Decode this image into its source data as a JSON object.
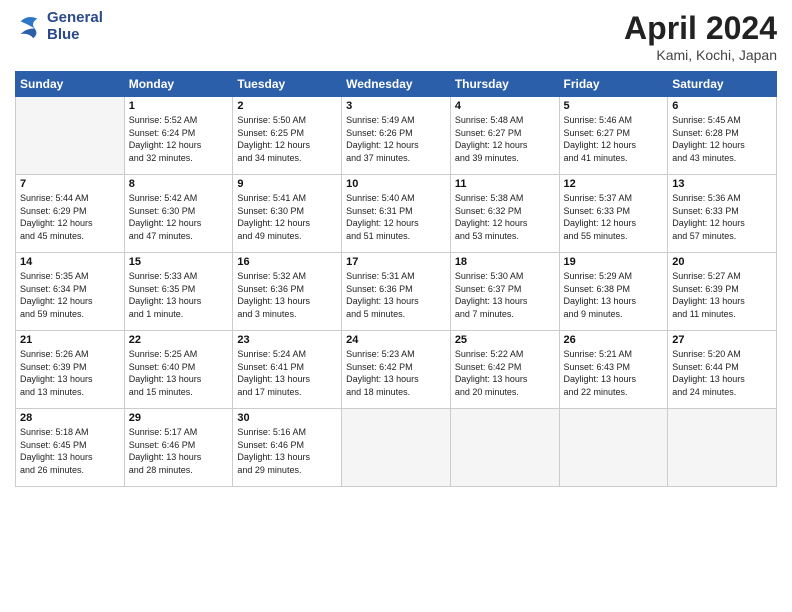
{
  "header": {
    "month_title": "April 2024",
    "location": "Kami, Kochi, Japan",
    "logo_line1": "General",
    "logo_line2": "Blue"
  },
  "weekdays": [
    "Sunday",
    "Monday",
    "Tuesday",
    "Wednesday",
    "Thursday",
    "Friday",
    "Saturday"
  ],
  "weeks": [
    [
      {
        "day": "",
        "info": ""
      },
      {
        "day": "1",
        "info": "Sunrise: 5:52 AM\nSunset: 6:24 PM\nDaylight: 12 hours\nand 32 minutes."
      },
      {
        "day": "2",
        "info": "Sunrise: 5:50 AM\nSunset: 6:25 PM\nDaylight: 12 hours\nand 34 minutes."
      },
      {
        "day": "3",
        "info": "Sunrise: 5:49 AM\nSunset: 6:26 PM\nDaylight: 12 hours\nand 37 minutes."
      },
      {
        "day": "4",
        "info": "Sunrise: 5:48 AM\nSunset: 6:27 PM\nDaylight: 12 hours\nand 39 minutes."
      },
      {
        "day": "5",
        "info": "Sunrise: 5:46 AM\nSunset: 6:27 PM\nDaylight: 12 hours\nand 41 minutes."
      },
      {
        "day": "6",
        "info": "Sunrise: 5:45 AM\nSunset: 6:28 PM\nDaylight: 12 hours\nand 43 minutes."
      }
    ],
    [
      {
        "day": "7",
        "info": "Sunrise: 5:44 AM\nSunset: 6:29 PM\nDaylight: 12 hours\nand 45 minutes."
      },
      {
        "day": "8",
        "info": "Sunrise: 5:42 AM\nSunset: 6:30 PM\nDaylight: 12 hours\nand 47 minutes."
      },
      {
        "day": "9",
        "info": "Sunrise: 5:41 AM\nSunset: 6:30 PM\nDaylight: 12 hours\nand 49 minutes."
      },
      {
        "day": "10",
        "info": "Sunrise: 5:40 AM\nSunset: 6:31 PM\nDaylight: 12 hours\nand 51 minutes."
      },
      {
        "day": "11",
        "info": "Sunrise: 5:38 AM\nSunset: 6:32 PM\nDaylight: 12 hours\nand 53 minutes."
      },
      {
        "day": "12",
        "info": "Sunrise: 5:37 AM\nSunset: 6:33 PM\nDaylight: 12 hours\nand 55 minutes."
      },
      {
        "day": "13",
        "info": "Sunrise: 5:36 AM\nSunset: 6:33 PM\nDaylight: 12 hours\nand 57 minutes."
      }
    ],
    [
      {
        "day": "14",
        "info": "Sunrise: 5:35 AM\nSunset: 6:34 PM\nDaylight: 12 hours\nand 59 minutes."
      },
      {
        "day": "15",
        "info": "Sunrise: 5:33 AM\nSunset: 6:35 PM\nDaylight: 13 hours\nand 1 minute."
      },
      {
        "day": "16",
        "info": "Sunrise: 5:32 AM\nSunset: 6:36 PM\nDaylight: 13 hours\nand 3 minutes."
      },
      {
        "day": "17",
        "info": "Sunrise: 5:31 AM\nSunset: 6:36 PM\nDaylight: 13 hours\nand 5 minutes."
      },
      {
        "day": "18",
        "info": "Sunrise: 5:30 AM\nSunset: 6:37 PM\nDaylight: 13 hours\nand 7 minutes."
      },
      {
        "day": "19",
        "info": "Sunrise: 5:29 AM\nSunset: 6:38 PM\nDaylight: 13 hours\nand 9 minutes."
      },
      {
        "day": "20",
        "info": "Sunrise: 5:27 AM\nSunset: 6:39 PM\nDaylight: 13 hours\nand 11 minutes."
      }
    ],
    [
      {
        "day": "21",
        "info": "Sunrise: 5:26 AM\nSunset: 6:39 PM\nDaylight: 13 hours\nand 13 minutes."
      },
      {
        "day": "22",
        "info": "Sunrise: 5:25 AM\nSunset: 6:40 PM\nDaylight: 13 hours\nand 15 minutes."
      },
      {
        "day": "23",
        "info": "Sunrise: 5:24 AM\nSunset: 6:41 PM\nDaylight: 13 hours\nand 17 minutes."
      },
      {
        "day": "24",
        "info": "Sunrise: 5:23 AM\nSunset: 6:42 PM\nDaylight: 13 hours\nand 18 minutes."
      },
      {
        "day": "25",
        "info": "Sunrise: 5:22 AM\nSunset: 6:42 PM\nDaylight: 13 hours\nand 20 minutes."
      },
      {
        "day": "26",
        "info": "Sunrise: 5:21 AM\nSunset: 6:43 PM\nDaylight: 13 hours\nand 22 minutes."
      },
      {
        "day": "27",
        "info": "Sunrise: 5:20 AM\nSunset: 6:44 PM\nDaylight: 13 hours\nand 24 minutes."
      }
    ],
    [
      {
        "day": "28",
        "info": "Sunrise: 5:18 AM\nSunset: 6:45 PM\nDaylight: 13 hours\nand 26 minutes."
      },
      {
        "day": "29",
        "info": "Sunrise: 5:17 AM\nSunset: 6:46 PM\nDaylight: 13 hours\nand 28 minutes."
      },
      {
        "day": "30",
        "info": "Sunrise: 5:16 AM\nSunset: 6:46 PM\nDaylight: 13 hours\nand 29 minutes."
      },
      {
        "day": "",
        "info": ""
      },
      {
        "day": "",
        "info": ""
      },
      {
        "day": "",
        "info": ""
      },
      {
        "day": "",
        "info": ""
      }
    ]
  ]
}
